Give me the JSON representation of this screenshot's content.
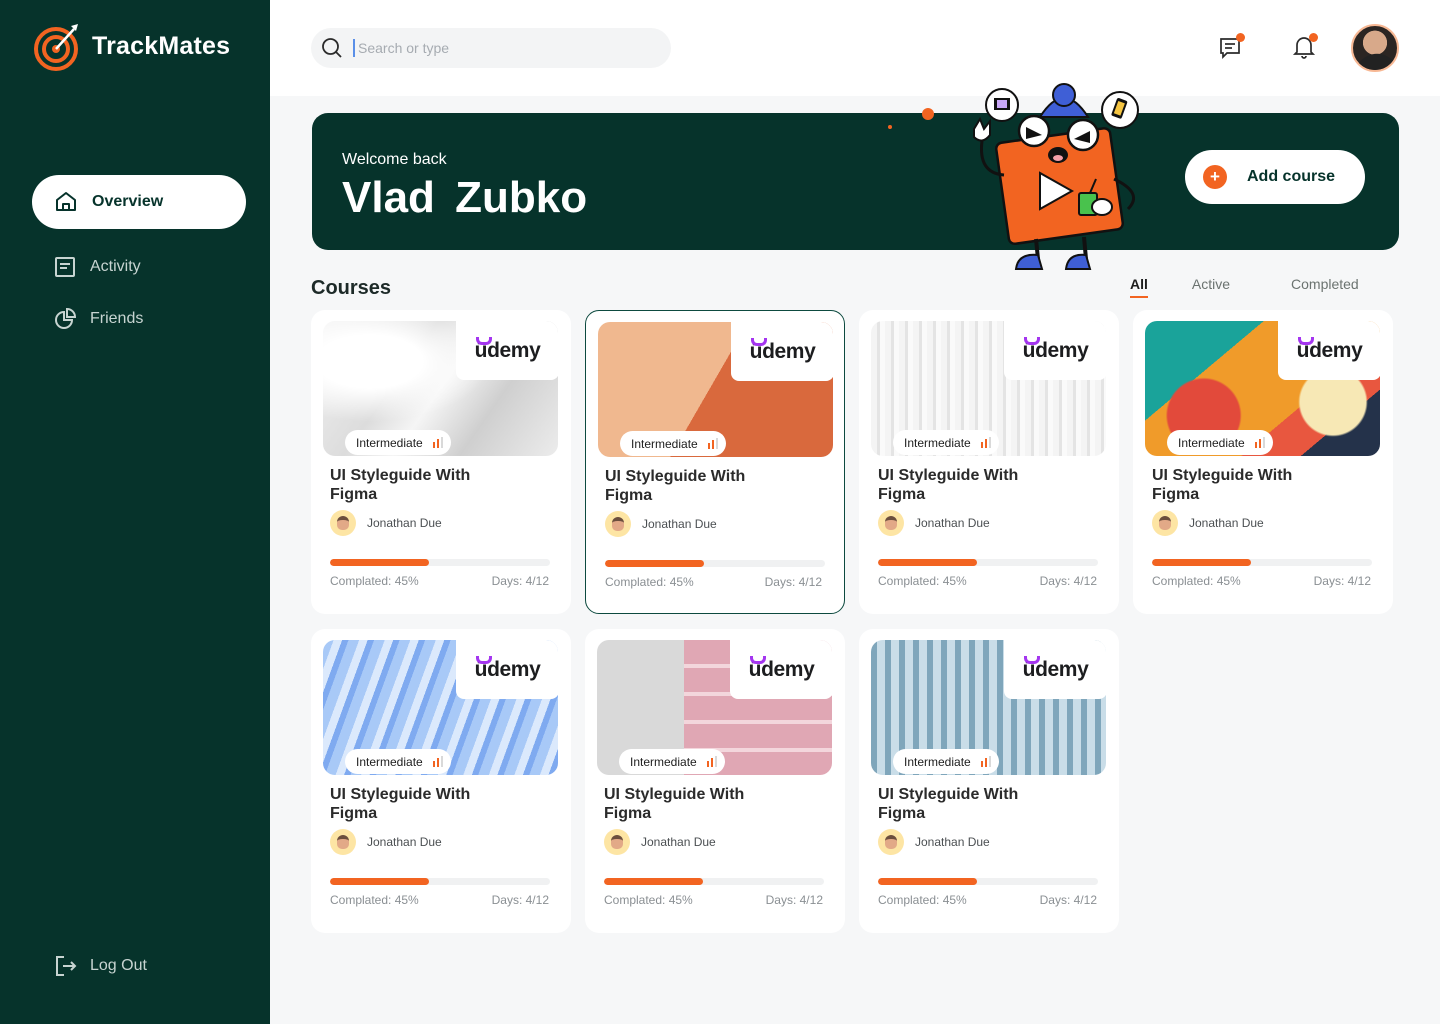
{
  "app": {
    "name": "TrackMates"
  },
  "sidebar": {
    "items": [
      {
        "label": "Overview",
        "icon": "home-icon",
        "active": true
      },
      {
        "label": "Activity",
        "icon": "activity-icon",
        "active": false
      },
      {
        "label": "Friends",
        "icon": "pie-chart-icon",
        "active": false
      }
    ],
    "logout_label": "Log Out"
  },
  "topbar": {
    "search_placeholder": "Search or type",
    "icons": [
      "chat-icon",
      "bell-icon"
    ]
  },
  "hero": {
    "welcome": "Welcome back",
    "name": "Vlad  Zubko",
    "add_course_label": "Add course"
  },
  "courses": {
    "title": "Courses",
    "filters": [
      "All",
      "Active",
      "Completed"
    ],
    "active_filter": "All",
    "items": [
      {
        "provider": "ūdemy",
        "level": "Intermediate",
        "title": "UI Styleguide With Figma",
        "author": "Jonathan Due",
        "completed": "Complated: 45%",
        "days": "Days: 4/12",
        "progress": 0.45
      },
      {
        "provider": "ūdemy",
        "level": "Intermediate",
        "title": "UI Styleguide With Figma",
        "author": "Jonathan Due",
        "completed": "Complated: 45%",
        "days": "Days: 4/12",
        "progress": 0.45
      },
      {
        "provider": "ūdemy",
        "level": "Intermediate",
        "title": "UI Styleguide With Figma",
        "author": "Jonathan Due",
        "completed": "Complated: 45%",
        "days": "Days: 4/12",
        "progress": 0.45
      },
      {
        "provider": "ūdemy",
        "level": "Intermediate",
        "title": "UI Styleguide With Figma",
        "author": "Jonathan Due",
        "completed": "Complated: 45%",
        "days": "Days: 4/12",
        "progress": 0.45
      },
      {
        "provider": "ūdemy",
        "level": "Intermediate",
        "title": "UI Styleguide With Figma",
        "author": "Jonathan Due",
        "completed": "Complated: 45%",
        "days": "Days: 4/12",
        "progress": 0.45
      },
      {
        "provider": "ūdemy",
        "level": "Intermediate",
        "title": "UI Styleguide With Figma",
        "author": "Jonathan Due",
        "completed": "Complated: 45%",
        "days": "Days: 4/12",
        "progress": 0.45
      },
      {
        "provider": "ūdemy",
        "level": "Intermediate",
        "title": "UI Styleguide With Figma",
        "author": "Jonathan Due",
        "completed": "Complated: 45%",
        "days": "Days: 4/12",
        "progress": 0.45
      }
    ]
  },
  "colors": {
    "sidebar": "#06332b",
    "accent": "#f26421",
    "udemy_purple": "#a435f0"
  }
}
